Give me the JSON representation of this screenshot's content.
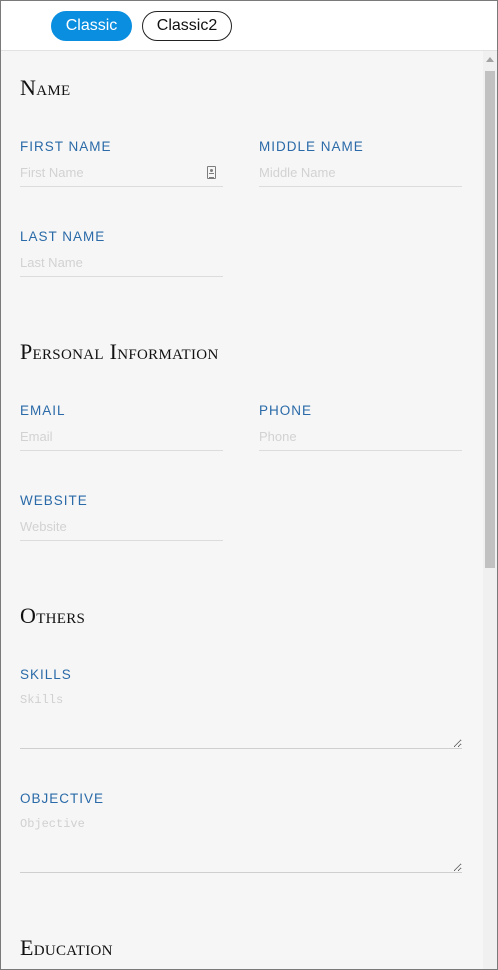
{
  "tabs": [
    {
      "label": "Classic",
      "active": true
    },
    {
      "label": "Classic2",
      "active": false
    }
  ],
  "sections": {
    "name": "Name",
    "personal": "Personal Information",
    "others": "Others",
    "education": "Education"
  },
  "fields": {
    "first_name": {
      "label": "First Name",
      "placeholder": "First Name",
      "value": ""
    },
    "middle_name": {
      "label": "Middle Name",
      "placeholder": "Middle Name",
      "value": ""
    },
    "last_name": {
      "label": "Last Name",
      "placeholder": "Last Name",
      "value": ""
    },
    "email": {
      "label": "Email",
      "placeholder": "Email",
      "value": ""
    },
    "phone": {
      "label": "Phone",
      "placeholder": "Phone",
      "value": ""
    },
    "website": {
      "label": "Website",
      "placeholder": "Website",
      "value": ""
    },
    "skills": {
      "label": "Skills",
      "placeholder": "Skills",
      "value": ""
    },
    "objective": {
      "label": "Objective",
      "placeholder": "Objective",
      "value": ""
    }
  },
  "icons": {
    "first_name_adornment": "contact-card-icon"
  },
  "colors": {
    "accent": "#0a8ee0",
    "label": "#2a6aa8"
  }
}
